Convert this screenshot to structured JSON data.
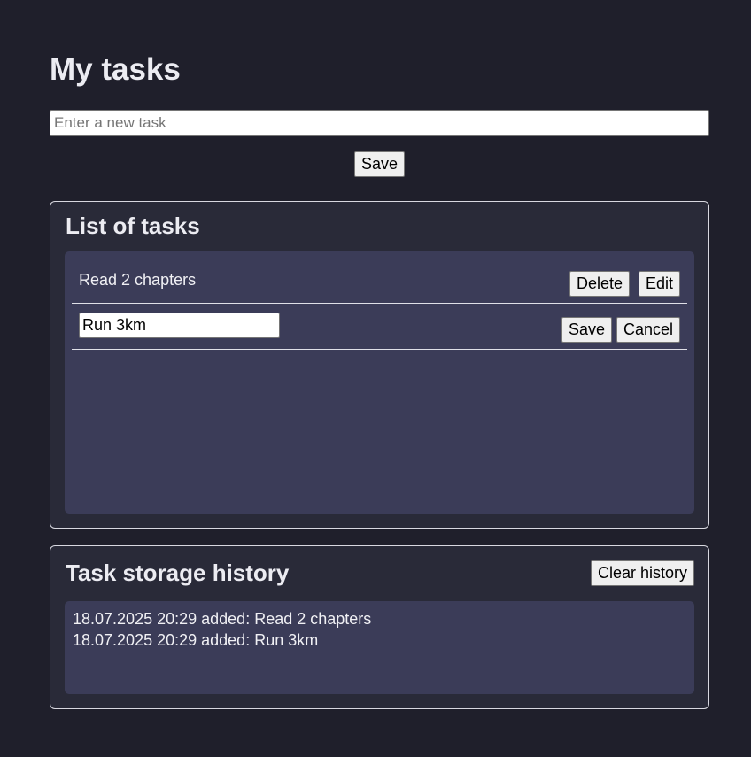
{
  "header": {
    "title": "My tasks"
  },
  "new_task": {
    "placeholder": "Enter a new task",
    "value": "",
    "save_label": "Save"
  },
  "tasks_panel": {
    "title": "List of tasks",
    "items": [
      {
        "text": "Read 2 chapters",
        "delete_label": "Delete",
        "edit_label": "Edit"
      },
      {
        "edit_value": "Run 3km",
        "save_label": "Save",
        "cancel_label": "Cancel"
      }
    ]
  },
  "history_panel": {
    "title": "Task storage history",
    "clear_label": "Clear history",
    "entries": [
      "18.07.2025 20:29 added: Read 2 chapters",
      "18.07.2025 20:29 added: Run 3km"
    ]
  }
}
